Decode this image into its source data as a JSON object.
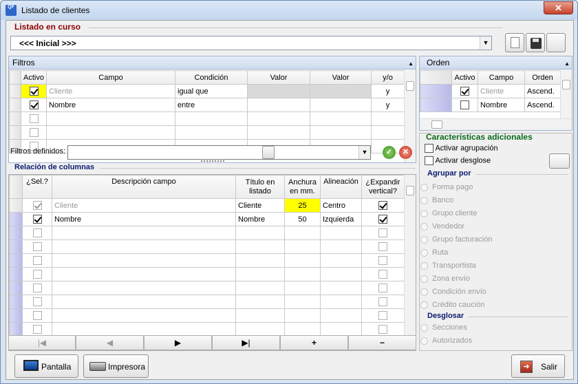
{
  "window": {
    "title": "Listado de clientes",
    "app_icon": "QF"
  },
  "listado": {
    "label": "Listado en curso",
    "value": "<<< Inicial >>>"
  },
  "filtros": {
    "header": "Filtros",
    "columns": [
      "Activo",
      "Campo",
      "Condición",
      "Valor",
      "Valor",
      "y/o"
    ],
    "rows": [
      {
        "active": true,
        "campo": "Cliente",
        "condicion": "igual que",
        "valor1": "",
        "valor2": "",
        "yo": "y"
      },
      {
        "active": true,
        "campo": "Nombre",
        "condicion": "entre",
        "valor1": "",
        "valor2": "",
        "yo": "y"
      }
    ],
    "defined_label": "Filtros definidos:"
  },
  "orden": {
    "header": "Orden",
    "columns": [
      "Activo",
      "Campo",
      "Orden"
    ],
    "rows": [
      {
        "active": true,
        "campo": "Cliente",
        "orden": "Ascend."
      },
      {
        "active": false,
        "campo": "Nombre",
        "orden": "Ascend."
      }
    ]
  },
  "caracteristicas": {
    "title": "Características adicionales",
    "agrupacion": "Activar agrupación",
    "desglose": "Activar desglose"
  },
  "agrupar": {
    "title": "Agrupar por",
    "options": [
      "Forma pago",
      "Banco",
      "Grupo cliente",
      "Vendedor",
      "Grupo facturación",
      "Ruta",
      "Transportista",
      "Zona envío",
      "Condición envío",
      "Crédito caución"
    ]
  },
  "desglosar": {
    "title": "Desglosar",
    "options": [
      "Secciones",
      "Autorizados"
    ]
  },
  "relacion": {
    "title": "Relación de columnas",
    "columns": [
      "¿Sel.?",
      "Descripción campo",
      "Título en listado",
      "Anchura en mm.",
      "Alineación",
      "¿Expandir vertical?"
    ],
    "rows": [
      {
        "sel": true,
        "desc": "Cliente",
        "titulo": "Cliente",
        "anchura": "25",
        "alin": "Centro",
        "expand": true
      },
      {
        "sel": true,
        "desc": "Nombre",
        "titulo": "Nombre",
        "anchura": "50",
        "alin": "Izquierda",
        "expand": true
      }
    ],
    "nav": [
      "|◀",
      "◀",
      "▶",
      "▶|",
      "+",
      "−"
    ]
  },
  "buttons": {
    "pantalla": "Pantalla",
    "impresora": "Impresora",
    "salir": "Salir"
  },
  "colors": {
    "title_red": "#8b0000",
    "group_blue": "#0b1a6e",
    "highlight": "#ffff00"
  }
}
